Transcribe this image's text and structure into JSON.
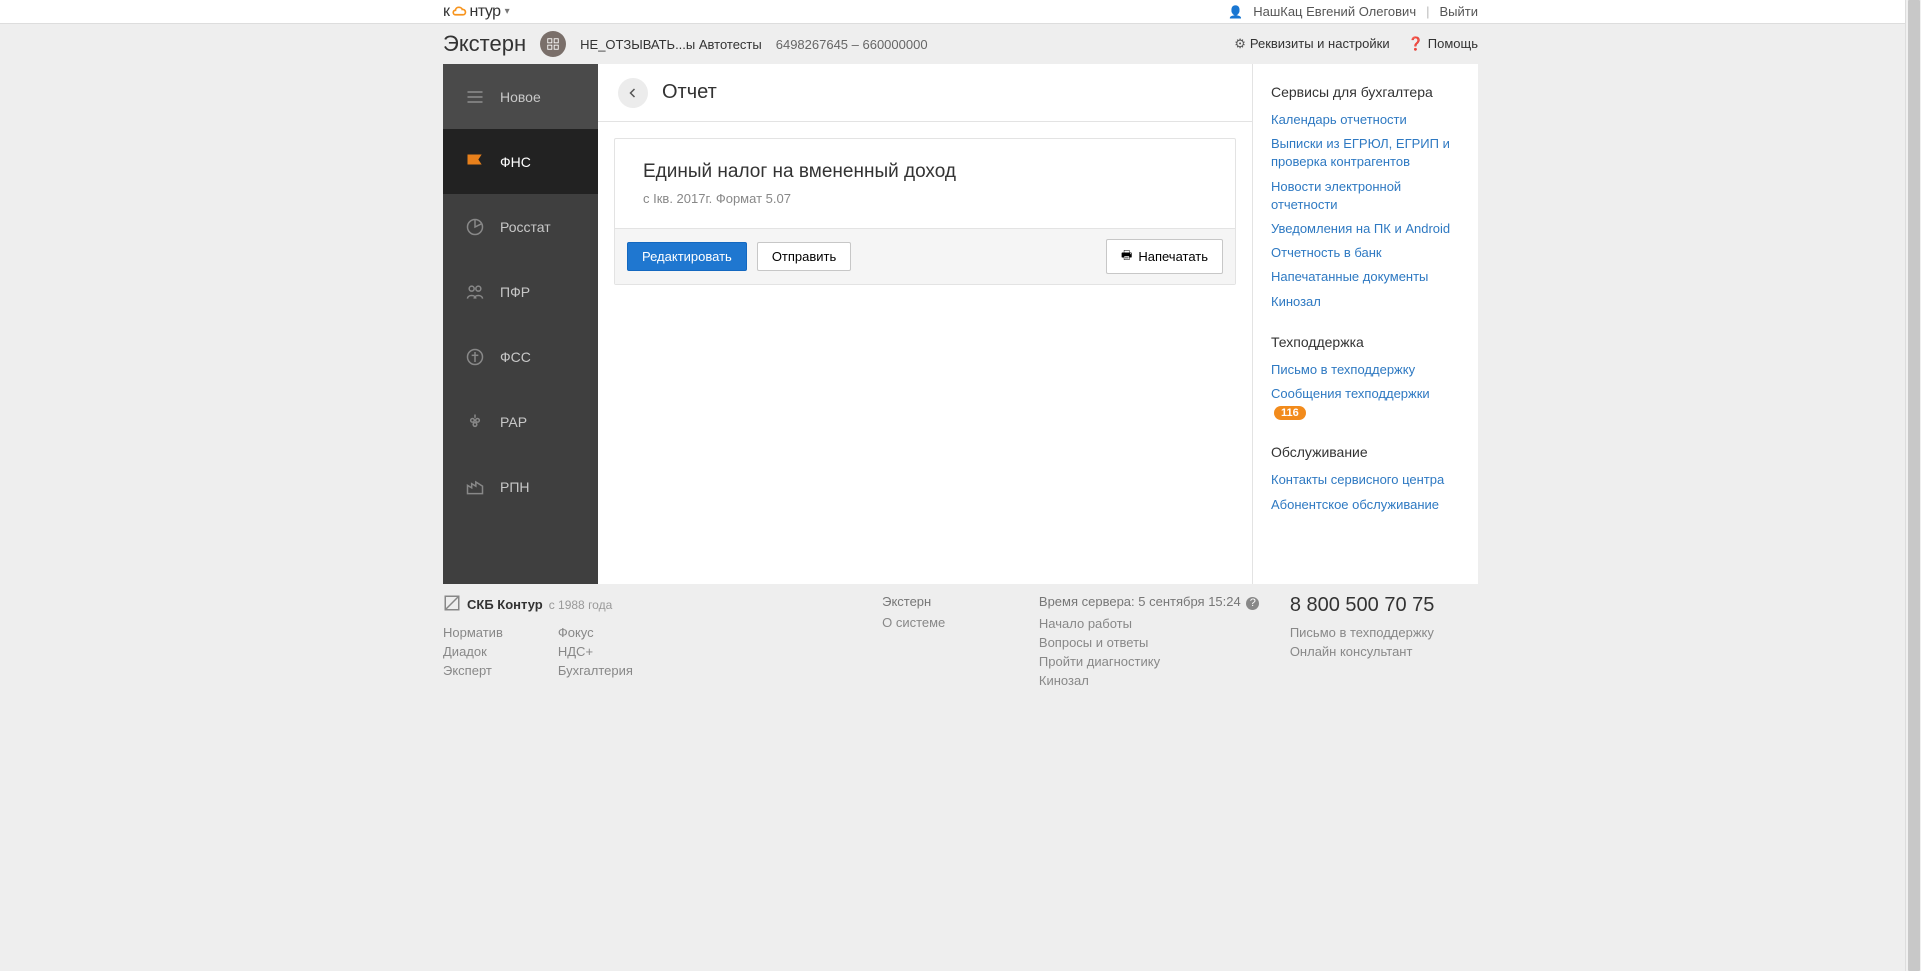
{
  "topbar": {
    "logo_prefix": "к",
    "logo_suffix": "нтур",
    "user": "НашКац Евгений Олегович",
    "logout": "Выйти"
  },
  "header": {
    "app_title": "Экстерн",
    "org_name": "НЕ_ОТЗЫВАТЬ...ы Автотесты",
    "org_code": "6498267645 – 660000000",
    "settings": "Реквизиты и настройки",
    "help": "Помощь"
  },
  "sidebar": {
    "items": [
      {
        "label": "Новое"
      },
      {
        "label": "ФНС"
      },
      {
        "label": "Росстат"
      },
      {
        "label": "ПФР"
      },
      {
        "label": "ФСС"
      },
      {
        "label": "РАР"
      },
      {
        "label": "РПН"
      }
    ]
  },
  "page": {
    "title": "Отчет",
    "report_title": "Единый налог на вмененный доход",
    "report_subtitle": "с Iкв. 2017г. Формат 5.07",
    "edit_btn": "Редактировать",
    "send_btn": "Отправить",
    "print_btn": "Напечатать"
  },
  "right_panel": {
    "section1_title": "Сервисы для бухгалтера",
    "links1": [
      "Календарь отчетности",
      "Выписки из ЕГРЮЛ, ЕГРИП и проверка контрагентов",
      "Новости электронной отчетности",
      "Уведомления на ПК и Android",
      "Отчетность в банк",
      "Напечатанные документы",
      "Кинозал"
    ],
    "section2_title": "Техподдержка",
    "links2_a": "Письмо в техподдержку",
    "links2_b": "Сообщения техподдержки",
    "badge": "116",
    "section3_title": "Обслуживание",
    "links3": [
      "Контакты сервисного центра",
      "Абонентское обслуживание"
    ]
  },
  "footer": {
    "brand": "СКБ Контур",
    "since": "с 1988 года",
    "col1": [
      "Норматив",
      "Диадок",
      "Эксперт"
    ],
    "col2": [
      "Фокус",
      "НДС+",
      "Бухгалтерия"
    ],
    "col3_head": "Экстерн",
    "col3_link": "О системе",
    "server_time_label": "Время сервера: ",
    "server_time": "5 сентября 15:24",
    "col4": [
      "Начало работы",
      "Вопросы и ответы",
      "Пройти диагностику",
      "Кинозал"
    ],
    "phone": "8 800 500 70 75",
    "support_mail": "Письмо в техподдержку",
    "online_consult": "Онлайн консультант"
  }
}
